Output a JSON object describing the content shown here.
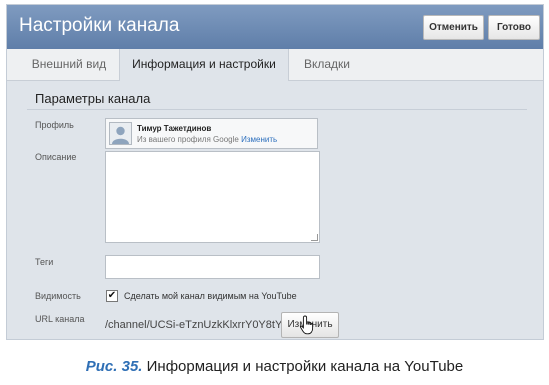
{
  "window": {
    "title": "Настройки канала",
    "buttons": {
      "cancel": "Отменить",
      "done": "Готово"
    }
  },
  "tabs": [
    {
      "label": "Внешний вид",
      "active": false
    },
    {
      "label": "Информация и настройки",
      "active": true
    },
    {
      "label": "Вкладки",
      "active": false
    }
  ],
  "section": {
    "title": "Параметры канала"
  },
  "fields": {
    "profile": {
      "label": "Профиль",
      "name": "Тимур Тажетдинов",
      "source": "Из вашего профиля Google",
      "change_link": "Изменить"
    },
    "description": {
      "label": "Описание",
      "value": ""
    },
    "tags": {
      "label": "Теги",
      "value": ""
    },
    "visibility": {
      "label": "Видимость",
      "checkbox_label": "Сделать мой канал видимым на YouTube",
      "checked": true
    },
    "url": {
      "label": "URL канала",
      "value": "/channel/UCSi-eTznUzkKlxrrY0Y8tYQ",
      "change_button": "Изменить"
    }
  },
  "caption": {
    "figure": "Рис. 35.",
    "text": "Информация и настройки канала на YouTube"
  },
  "colors": {
    "titlebar": "#6d8ab3",
    "panel": "#dfe4ea",
    "link": "#2c6fbd",
    "caption_accent": "#2f6fb5"
  },
  "icons": {
    "avatar": "user-silhouette-icon",
    "cursor": "hand-pointer-icon",
    "check": "checkmark-icon"
  }
}
